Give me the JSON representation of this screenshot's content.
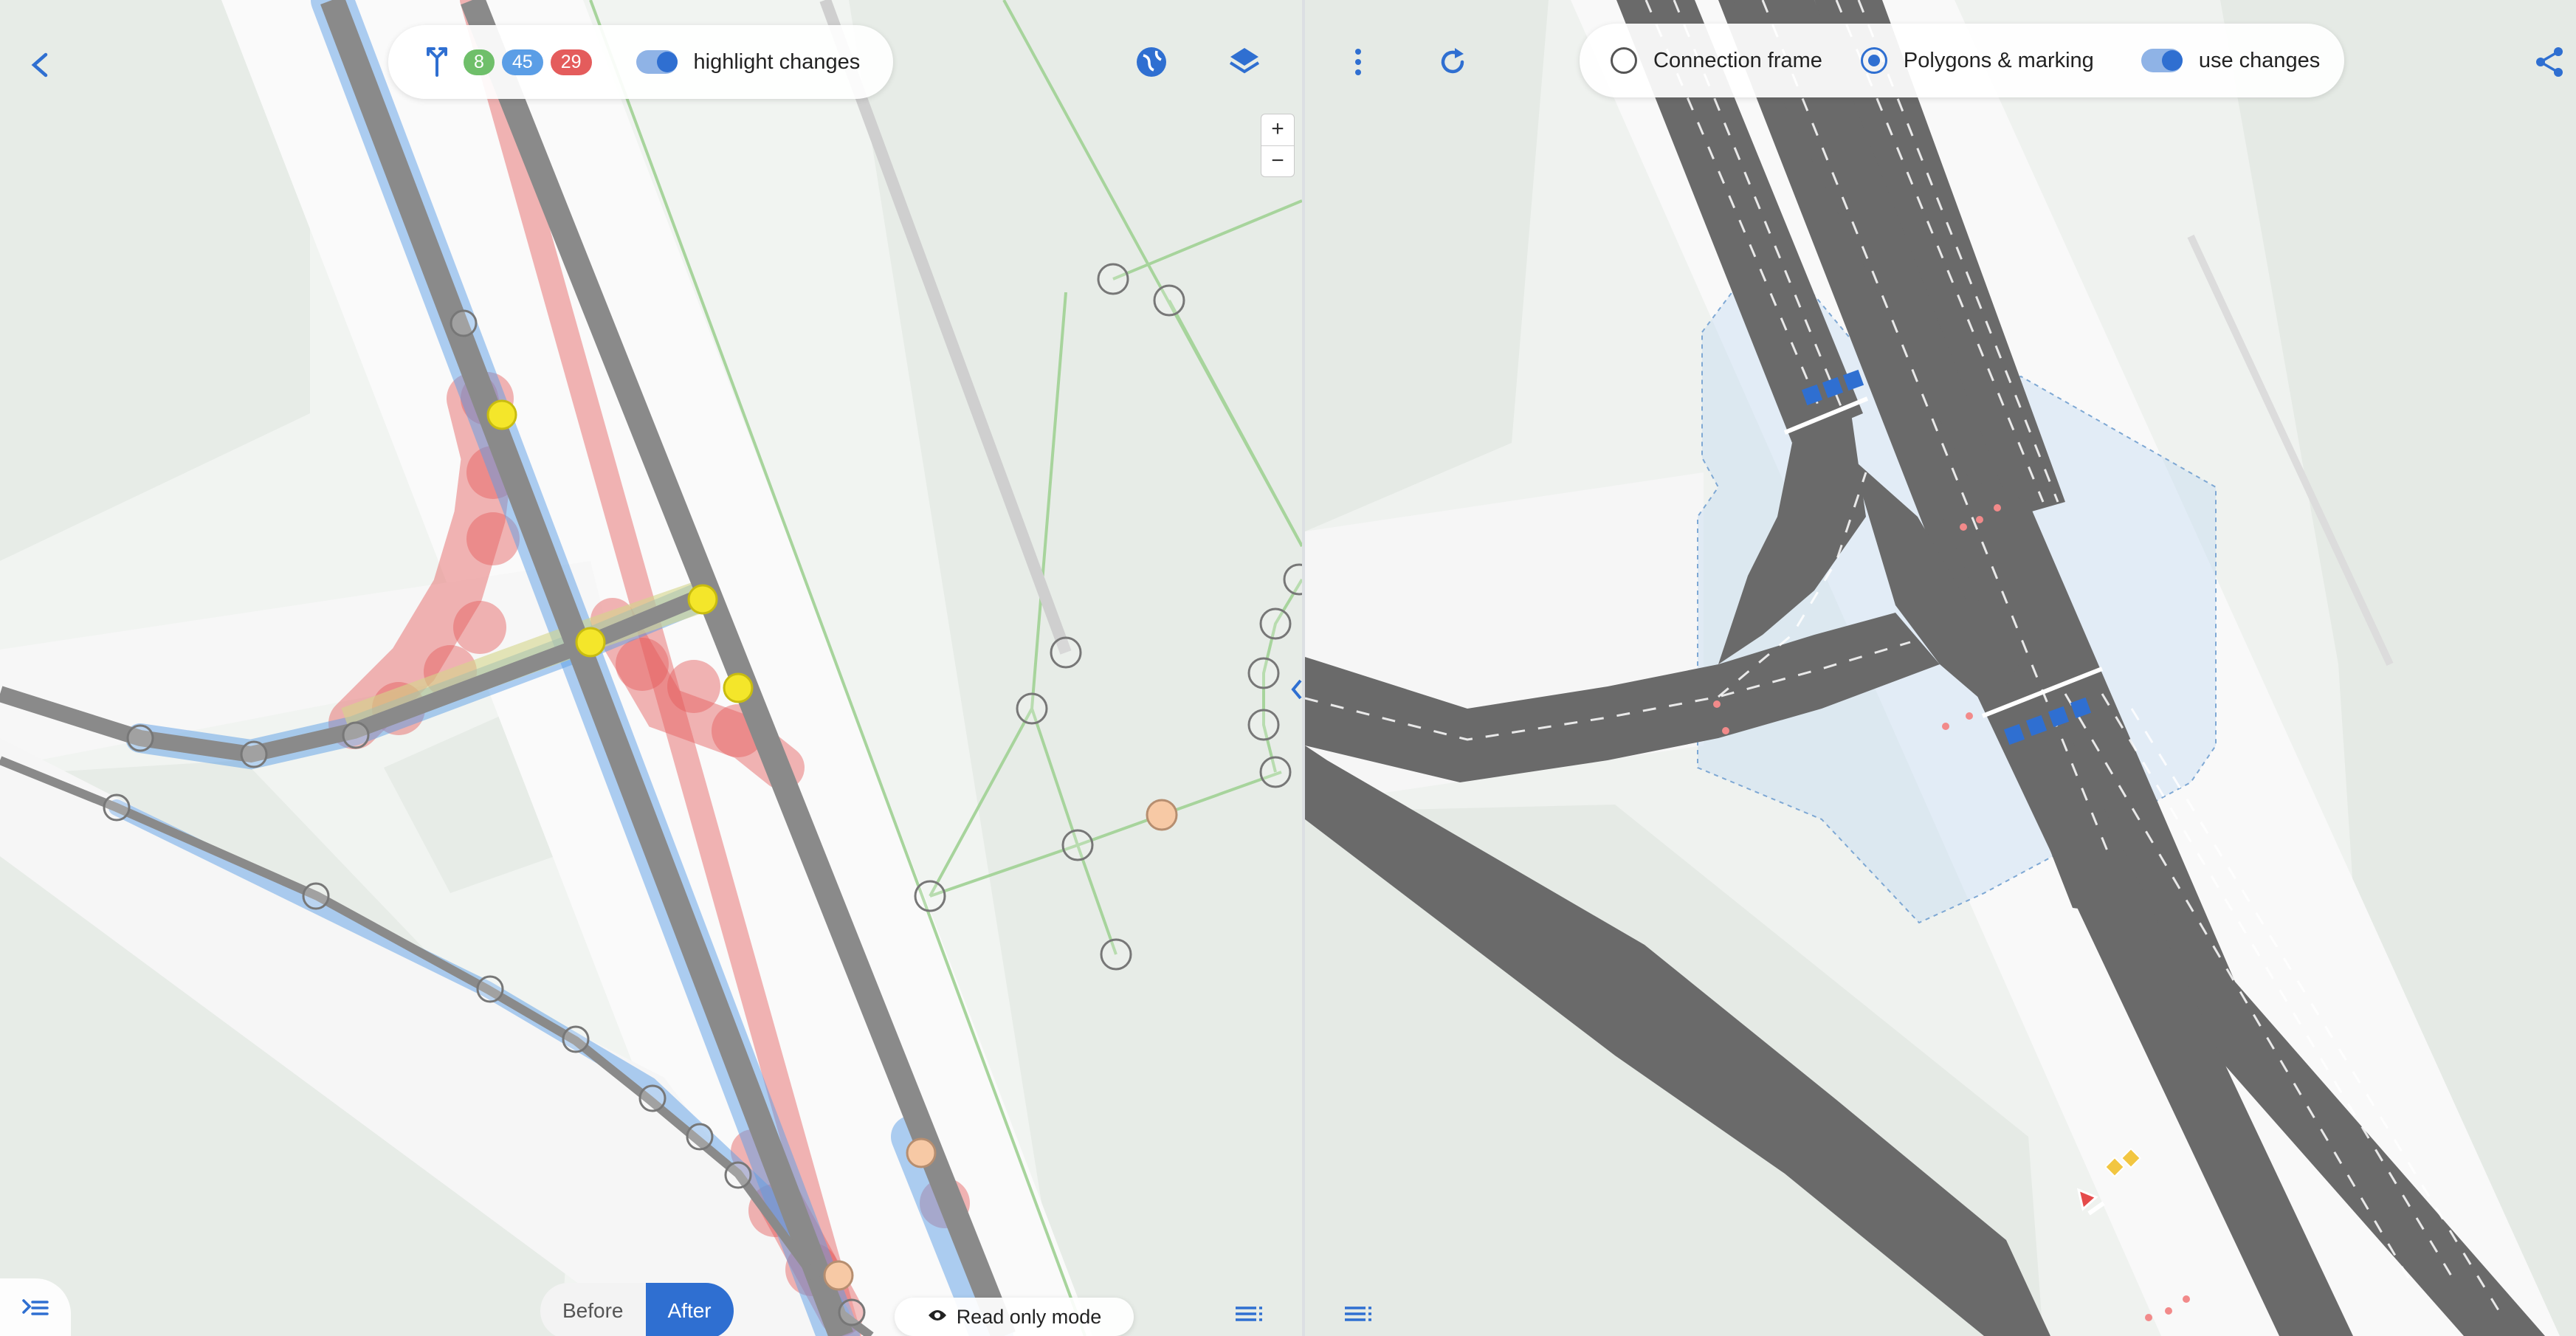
{
  "left_toolbar": {
    "badges": {
      "new": "8",
      "modified": "45",
      "deleted": "29"
    },
    "highlight_label": "highlight changes",
    "highlight_on": true
  },
  "right_toolbar": {
    "options": [
      {
        "label": "Connection frame",
        "selected": false
      },
      {
        "label": "Polygons & marking",
        "selected": true
      }
    ],
    "use_changes_label": "use changes",
    "use_changes_on": true
  },
  "zoom": {
    "in": "+",
    "out": "−"
  },
  "view_toggle": {
    "before": "Before",
    "after": "After",
    "selected": "After"
  },
  "read_only_label": "Read only mode",
  "colors": {
    "accent": "#2f6fd1",
    "new": "#6fbf6a",
    "modified": "#5b9ee6",
    "deleted": "#e45c5c",
    "road": "#8a8a8a",
    "highlight_node": "#f4e62a"
  },
  "icons": [
    "back-icon",
    "branch-icon",
    "globe-icon",
    "layers-icon",
    "more-vert-icon",
    "refresh-icon",
    "share-icon",
    "edit-list-icon",
    "list-icon",
    "split-arrows-icon",
    "eye-icon"
  ]
}
